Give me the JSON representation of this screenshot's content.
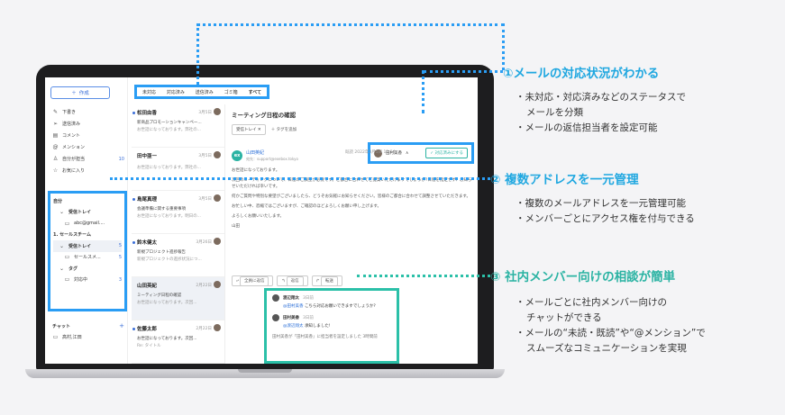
{
  "sidebar": {
    "compose_label": "作成",
    "nav": [
      {
        "label": "下書き",
        "icon": "pencil-icon",
        "count": ""
      },
      {
        "label": "送信済み",
        "icon": "send-icon",
        "count": ""
      },
      {
        "label": "コメント",
        "icon": "comment-icon",
        "count": ""
      },
      {
        "label": "メンション",
        "icon": "at-icon",
        "count": ""
      },
      {
        "label": "自分が担当",
        "icon": "person-icon",
        "count": "10"
      },
      {
        "label": "お気に入り",
        "icon": "star-icon",
        "count": ""
      }
    ],
    "accounts": [
      {
        "label": "自分",
        "count": "",
        "indent": 0,
        "bold": true
      },
      {
        "label": "受信トレイ",
        "count": "",
        "indent": 1,
        "bold": true
      },
      {
        "label": "abc@gmail....",
        "count": "",
        "indent": 2,
        "bold": false
      },
      {
        "label": "1. セールスチーム",
        "count": "",
        "indent": 0,
        "bold": true
      },
      {
        "label": "受信トレイ",
        "count": "5",
        "indent": 1,
        "bold": true
      },
      {
        "label": "セールスメ...",
        "count": "5",
        "indent": 2,
        "bold": false
      },
      {
        "label": "タグ",
        "count": "",
        "indent": 1,
        "bold": true
      },
      {
        "label": "対応中",
        "count": "3",
        "indent": 2,
        "bold": false
      }
    ],
    "chat_label": "チャット",
    "chat_member": "高村,江田"
  },
  "filters": [
    "未対応",
    "対応済み",
    "送信済み",
    "ゴミ箱",
    "すべて"
  ],
  "messages": [
    {
      "name": "松田由香",
      "date": "3月5日",
      "subject": "新商品プロモーションキャンペー...",
      "preview": "お世話になっております。弊社の...",
      "unread": true
    },
    {
      "name": "田中亜一",
      "date": "3月5日",
      "subject": "",
      "preview": "お世話になっております。弊社の...",
      "unread": false
    },
    {
      "name": "島尾真理",
      "date": "3月5日",
      "subject": "会議準備に関する重要事項",
      "preview": "お世話になっております。明日の...",
      "unread": true
    },
    {
      "name": "鈴木健太",
      "date": "3月26日",
      "subject": "新規プロジェクト進捗報告",
      "preview": "新規プロジェクトの進捗状況につ...",
      "unread": true
    },
    {
      "name": "山田英紀",
      "date": "2月22日",
      "subject": "ミーティング日程の確認",
      "preview": "お世話になっております。次回...",
      "unread": false,
      "selected": true
    },
    {
      "name": "佐藤太郎",
      "date": "2月22日",
      "subject": "お世話になっております。次回...",
      "preview": "Re: タイトル",
      "unread": true
    }
  ],
  "detail": {
    "subject": "ミーティング日程の確認",
    "chip": "受信トレイ",
    "tag_add": "＋ タグを追加",
    "assignee": "田村美香",
    "done_label": "対応済みにする",
    "sender_name": "山田英紀",
    "sender_addr": "宛先：support@exebox.tokyo",
    "meta": "既読  2022年3月5日 12:34",
    "body": [
      "お世話になっております。",
      "次回のミーティングについて、日程のご調整が必要です。ご都合に合わせてご提案いただけますでしょうか?日程を指定せず、お知らせいただければ幸いです。",
      "何かご質問や特別な要望がございましたら、どうぞお気軽にお知らせください。皆様のご都合に合わせて調整させていただきます。",
      "お忙しい中、恐縮ではございますが、ご確認のほどよろしくお願い申し上げます。",
      "よろしくお願いいたします。",
      "山田"
    ],
    "reply_all": "全員に返信",
    "reply": "返信",
    "forward": "転送",
    "comments": [
      {
        "who": "渡辺翔太",
        "time": "3日前",
        "mention": "@田村美香",
        "text": "こちら対応お願いできますでしょうか?"
      },
      {
        "who": "田村美香",
        "time": "3日前",
        "mention": "@渡辺翔太",
        "text": "承知しました!"
      }
    ],
    "log": "田村美香が「田村美香」に担当者を設定しました  3時間前"
  },
  "annotations": [
    {
      "title": "①メールの対応状況がわかる",
      "lines": [
        [
          "・未対応・対応済みなどのステータスで",
          "メールを分類"
        ],
        [
          "・メールの返信担当者を設定可能"
        ]
      ]
    },
    {
      "title": "② 複数アドレスを一元管理",
      "lines": [
        [
          "・複数のメールアドレスを一元管理可能"
        ],
        [
          "・メンバーごとにアクセス権を付与できる"
        ]
      ]
    },
    {
      "title": "③ 社内メンバー向けの相談が簡単",
      "lines": [
        [
          "・メールごとに社内メンバー向けの",
          "チャットができる"
        ],
        [
          "・メールの“未読・既読”や“@メンション”で",
          "スムーズなコミュニケーションを実現"
        ]
      ]
    }
  ],
  "colors": {
    "accent_blue": "#2a9df4",
    "accent_teal": "#2bc0a8"
  }
}
